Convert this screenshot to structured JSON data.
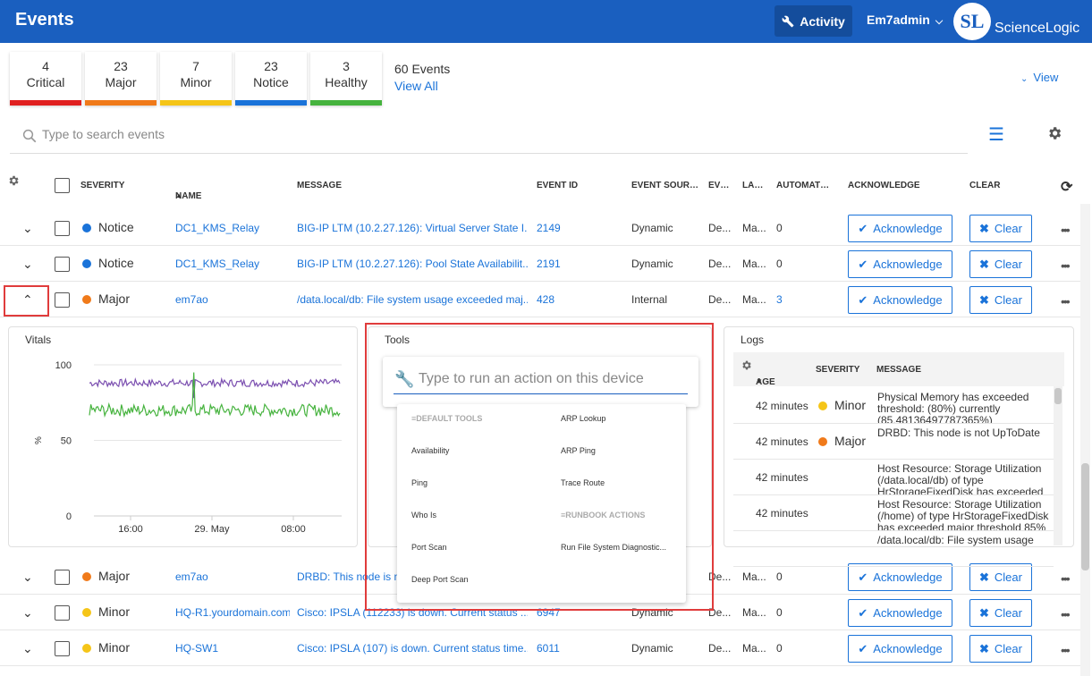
{
  "app": {
    "title": "Events",
    "activity_label": "Activity",
    "user": "Em7admin",
    "logo_mark": "SL",
    "logo_text": "ScienceLogic"
  },
  "summary": {
    "cards": [
      {
        "count": "4",
        "label": "Critical",
        "color": "#e02020"
      },
      {
        "count": "23",
        "label": "Major",
        "color": "#f07a1a"
      },
      {
        "count": "7",
        "label": "Minor",
        "color": "#f5c518"
      },
      {
        "count": "23",
        "label": "Notice",
        "color": "#1a73d9"
      },
      {
        "count": "3",
        "label": "Healthy",
        "color": "#46b33e"
      }
    ],
    "total": "60 Events",
    "view_all": "View All",
    "view": "View"
  },
  "search": {
    "placeholder": "Type to search events"
  },
  "columns": {
    "severity": "SEVERITY",
    "name": "NAME",
    "message": "MESSAGE",
    "event_id": "EVENT ID",
    "event_source": "EVENT SOUR…",
    "ev": "EV…",
    "la": "LA…",
    "automation": "AUTOMAT…",
    "acknowledge": "ACKNOWLEDGE",
    "clear": "CLEAR"
  },
  "buttons": {
    "acknowledge": "Acknowledge",
    "clear": "Clear"
  },
  "rows": [
    {
      "severity": "Notice",
      "color": "#1a73d9",
      "name": "DC1_KMS_Relay",
      "message": "BIG-IP LTM (10.2.27.126): Virtual Server State I...",
      "event_id": "2149",
      "source": "Dynamic",
      "ev": "De...",
      "la": "Ma...",
      "automation": "0",
      "expanded": false
    },
    {
      "severity": "Notice",
      "color": "#1a73d9",
      "name": "DC1_KMS_Relay",
      "message": "BIG-IP LTM (10.2.27.126): Pool State Availabilit...",
      "event_id": "2191",
      "source": "Dynamic",
      "ev": "De...",
      "la": "Ma...",
      "automation": "0",
      "expanded": false
    },
    {
      "severity": "Major",
      "color": "#f07a1a",
      "name": "em7ao",
      "message": "/data.local/db: File system usage exceeded maj...",
      "event_id": "428",
      "source": "Internal",
      "ev": "De...",
      "la": "Ma...",
      "automation": "3",
      "expanded": true
    },
    {
      "severity": "Major",
      "color": "#f07a1a",
      "name": "em7ao",
      "message": "DRBD: This node is n",
      "event_id": "",
      "source": "",
      "ev": "De...",
      "la": "Ma...",
      "automation": "0",
      "expanded": false
    },
    {
      "severity": "Minor",
      "color": "#f5c518",
      "name": "HQ-R1.yourdomain.com",
      "message": "Cisco: IPSLA (112233) is down. Current status ...",
      "event_id": "6947",
      "source": "Dynamic",
      "ev": "De...",
      "la": "Ma...",
      "automation": "0",
      "expanded": false
    },
    {
      "severity": "Minor",
      "color": "#f5c518",
      "name": "HQ-SW1",
      "message": "Cisco: IPSLA (107) is down. Current status time...",
      "event_id": "6011",
      "source": "Dynamic",
      "ev": "De...",
      "la": "Ma...",
      "automation": "0",
      "expanded": false
    }
  ],
  "vitals": {
    "title": "Vitals",
    "y_label": "%",
    "y_ticks": [
      "100",
      "50",
      "0"
    ],
    "x_ticks": [
      "16:00",
      "29. May",
      "08:00"
    ]
  },
  "chart_data": {
    "type": "line",
    "title": "Vitals",
    "xlabel": "",
    "ylabel": "%",
    "ylim": [
      0,
      100
    ],
    "x": [
      "16:00",
      "29. May",
      "08:00"
    ],
    "series": [
      {
        "color": "#7b4fb0",
        "approx_value": 88
      },
      {
        "color": "#46b33e",
        "approx_value": 70
      }
    ],
    "grid": true
  },
  "tools": {
    "title": "Tools",
    "placeholder": "Type to run an action on this device",
    "default_section": "DEFAULT TOOLS",
    "runbook_section": "RUNBOOK ACTIONS",
    "items": [
      "ARP Lookup",
      "Availability",
      "ARP Ping",
      "Ping",
      "Trace Route",
      "Who Is",
      "Port Scan",
      "Run File System Diagnostic...",
      "Deep Port Scan"
    ]
  },
  "logs": {
    "title": "Logs",
    "columns": {
      "age": "AGE",
      "severity": "SEVERITY",
      "message": "MESSAGE"
    },
    "rows": [
      {
        "age": "42 minutes",
        "severity": "Minor",
        "color": "#f5c518",
        "message": "Physical Memory has exceeded threshold: (80%) currently (85.48136497787365%)"
      },
      {
        "age": "42 minutes",
        "severity": "Major",
        "color": "#f07a1a",
        "message": "DRBD: This node is not UpToDate"
      },
      {
        "age": "42 minutes",
        "severity": "",
        "color": "",
        "message": "Host Resource: Storage Utilization (/data.local/db) of type HrStorageFixedDisk has exceeded"
      },
      {
        "age": "42 minutes",
        "severity": "",
        "color": "",
        "message": "Host Resource: Storage Utilization (/home) of type HrStorageFixedDisk has exceeded major threshold 85%"
      },
      {
        "age": "",
        "severity": "",
        "color": "",
        "message": "/data.local/db: File system usage"
      }
    ]
  }
}
